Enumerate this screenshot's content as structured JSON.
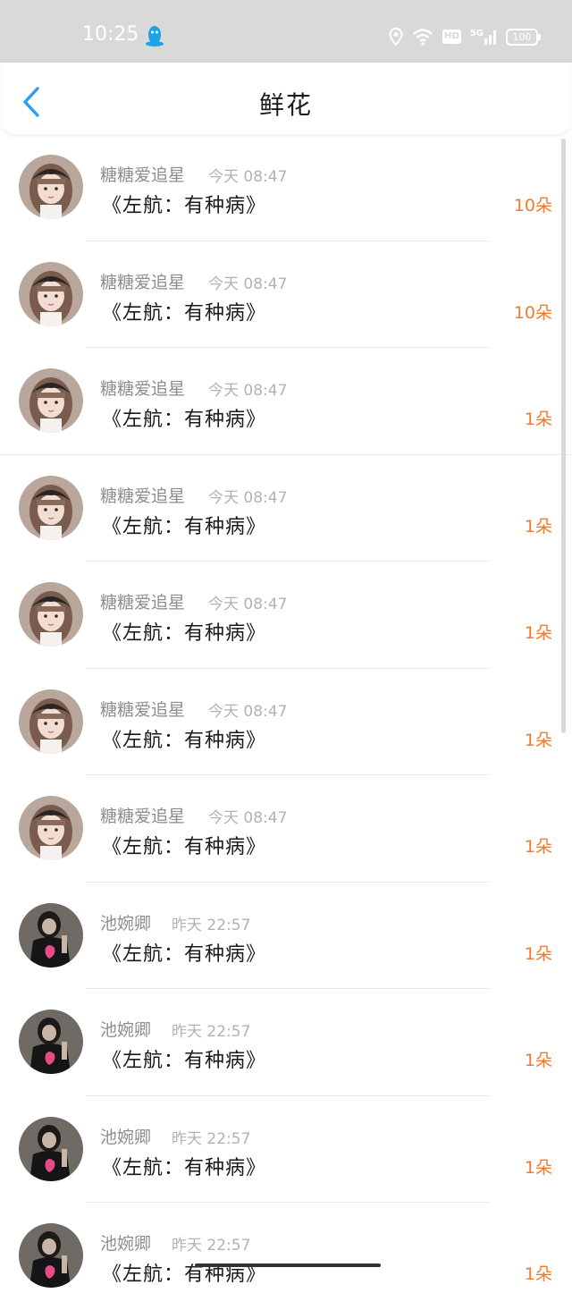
{
  "status_bar": {
    "time": "10:25",
    "battery": "100",
    "network": "5G",
    "hd": "HD"
  },
  "header": {
    "title": "鲜花"
  },
  "items": [
    {
      "name": "糖糖爱追星",
      "time": "今天 08:47",
      "title": "《左航：有种病》",
      "count": "10朵",
      "avatar": "girl-avatar"
    },
    {
      "name": "糖糖爱追星",
      "time": "今天 08:47",
      "title": "《左航：有种病》",
      "count": "10朵",
      "avatar": "girl-avatar"
    },
    {
      "name": "糖糖爱追星",
      "time": "今天 08:47",
      "title": "《左航：有种病》",
      "count": "1朵",
      "avatar": "girl-avatar"
    },
    {
      "name": "糖糖爱追星",
      "time": "今天 08:47",
      "title": "《左航：有种病》",
      "count": "1朵",
      "avatar": "girl-avatar"
    },
    {
      "name": "糖糖爱追星",
      "time": "今天 08:47",
      "title": "《左航：有种病》",
      "count": "1朵",
      "avatar": "girl-avatar"
    },
    {
      "name": "糖糖爱追星",
      "time": "今天 08:47",
      "title": "《左航：有种病》",
      "count": "1朵",
      "avatar": "girl-avatar"
    },
    {
      "name": "糖糖爱追星",
      "time": "今天 08:47",
      "title": "《左航：有种病》",
      "count": "1朵",
      "avatar": "girl-avatar"
    },
    {
      "name": "池婉卿",
      "time": "昨天 22:57",
      "title": "《左航：有种病》",
      "count": "1朵",
      "avatar": "dark-avatar"
    },
    {
      "name": "池婉卿",
      "time": "昨天 22:57",
      "title": "《左航：有种病》",
      "count": "1朵",
      "avatar": "dark-avatar"
    },
    {
      "name": "池婉卿",
      "time": "昨天 22:57",
      "title": "《左航：有种病》",
      "count": "1朵",
      "avatar": "dark-avatar"
    },
    {
      "name": "池婉卿",
      "time": "昨天 22:57",
      "title": "《左航：有种病》",
      "count": "1朵",
      "avatar": "dark-avatar"
    }
  ],
  "colors": {
    "accent": "#2a9df4",
    "count": "#f07a2d",
    "status_bar": "#d9d9d9"
  }
}
